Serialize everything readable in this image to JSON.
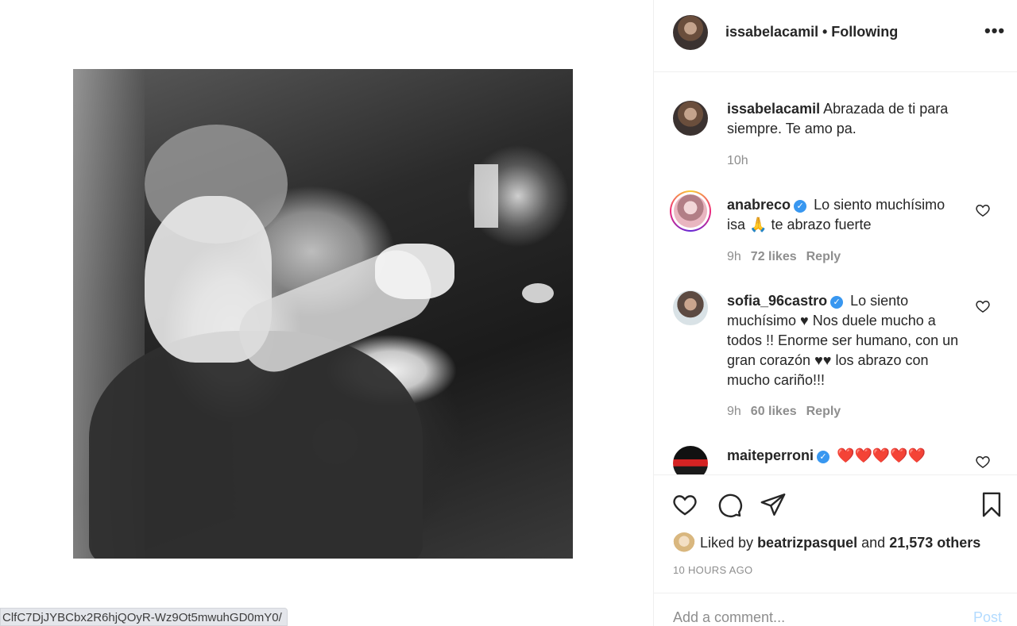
{
  "url_chip": "ClfC7DjJYBCbx2R6hjQOyR-Wz9Ot5mwuhGD0mY0/",
  "header": {
    "username": "issabelacamil",
    "follow_status": "• Following",
    "more_icon": "more-horizontal-icon"
  },
  "caption": {
    "username": "issabelacamil",
    "text": "Abrazada de ti para siempre. Te amo pa.",
    "time": "10h"
  },
  "comments": [
    {
      "username": "anabreco",
      "verified": true,
      "text_a": "Lo siento muchísimo isa",
      "emoji": "🙏",
      "text_b": "te abrazo fuerte",
      "time": "9h",
      "likes": "72 likes",
      "reply": "Reply"
    },
    {
      "username": "sofia_96castro",
      "verified": true,
      "text": "Lo siento muchísimo ♥ Nos duele mucho a todos !! Enorme ser humano, con un gran corazón ♥♥ los abrazo con mucho cariño!!!",
      "time": "9h",
      "likes": "60 likes",
      "reply": "Reply"
    },
    {
      "username": "maiteperroni",
      "verified": true,
      "text": "❤️❤️❤️❤️❤️"
    }
  ],
  "actions": {
    "like_icon": "heart-icon",
    "comment_icon": "comment-icon",
    "share_icon": "paper-plane-icon",
    "save_icon": "bookmark-icon"
  },
  "liked_by": {
    "prefix": "Liked by",
    "user": "beatrizpasquel",
    "connector": "and",
    "others": "21,573 others"
  },
  "timestamp": "10 HOURS AGO",
  "comment_input": {
    "placeholder": "Add a comment...",
    "post_label": "Post"
  },
  "colors": {
    "verified": "#3897f0",
    "post_disabled": "#b3dbff",
    "meta_gray": "#8e8e8e"
  }
}
